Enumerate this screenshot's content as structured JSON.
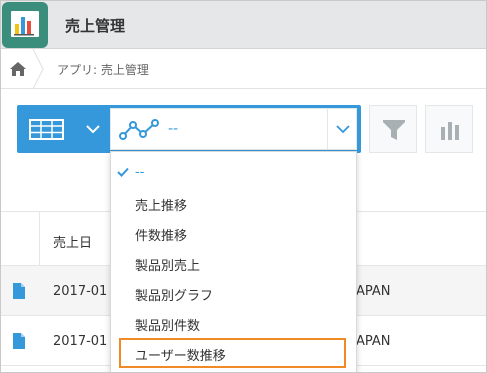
{
  "header": {
    "app_title": "売上管理",
    "app_icon": "bar-chart-app-icon"
  },
  "breadcrumb": {
    "home_icon": "home-icon",
    "text": "アプリ: 売上管理"
  },
  "toolbar": {
    "view_icon": "table-view-icon",
    "selected_graph": "--",
    "filter_icon": "filter-funnel-icon",
    "graph_icon": "bar-graph-icon"
  },
  "grid": {
    "column_header": "売上日",
    "rows": [
      {
        "date": "2017-01",
        "country": "APAN"
      },
      {
        "date": "2017-01",
        "country": "APAN"
      }
    ]
  },
  "dropdown": {
    "items": [
      {
        "label": "--",
        "selected": true
      },
      {
        "label": "売上推移"
      },
      {
        "label": "件数推移"
      },
      {
        "label": "製品別売上"
      },
      {
        "label": "製品別グラフ"
      },
      {
        "label": "製品別件数"
      },
      {
        "label": "ユーザー数推移",
        "highlighted": true
      }
    ]
  },
  "colors": {
    "accent": "#3498db",
    "highlight": "#f08a24",
    "app_icon_bg": "#3b8e7c"
  }
}
